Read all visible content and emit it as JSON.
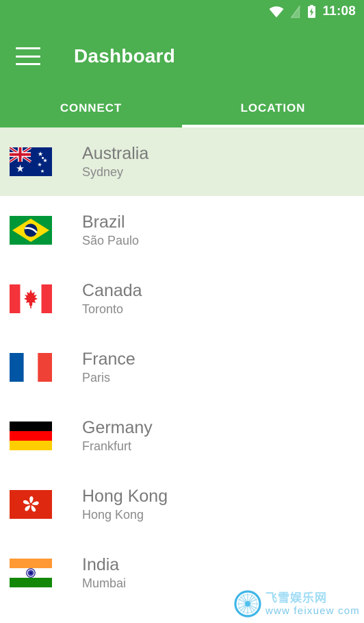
{
  "statusbar": {
    "icons": [
      "wifi-icon",
      "signal-off-icon",
      "battery-charging-icon"
    ],
    "time": "11:08"
  },
  "appbar": {
    "menu_icon": "hamburger-menu-icon",
    "title": "Dashboard"
  },
  "tabs": {
    "items": [
      {
        "label": "CONNECT",
        "active": false
      },
      {
        "label": "LOCATION",
        "active": true
      }
    ],
    "active_index": 1,
    "indicator_color": "#FFFFFF"
  },
  "colors": {
    "primary": "#4CAF50",
    "selected_row": "#E4EFDC",
    "title_text": "#7A7A7A",
    "subtitle_text": "#8A8A8A",
    "background": "#FFFFFF"
  },
  "list": {
    "items": [
      {
        "flag": "flag-australia",
        "country": "Australia",
        "city": "Sydney",
        "selected": true
      },
      {
        "flag": "flag-brazil",
        "country": "Brazil",
        "city": "São Paulo",
        "selected": false
      },
      {
        "flag": "flag-canada",
        "country": "Canada",
        "city": "Toronto",
        "selected": false
      },
      {
        "flag": "flag-france",
        "country": "France",
        "city": "Paris",
        "selected": false
      },
      {
        "flag": "flag-germany",
        "country": "Germany",
        "city": "Frankfurt",
        "selected": false
      },
      {
        "flag": "flag-hong-kong",
        "country": "Hong Kong",
        "city": "Hong Kong",
        "selected": false
      },
      {
        "flag": "flag-india",
        "country": "India",
        "city": "Mumbai",
        "selected": false
      }
    ]
  },
  "watermark": {
    "logo": "compass-logo-icon",
    "chinese": "飞雪娱乐网",
    "url": "www  feixuew  com"
  }
}
